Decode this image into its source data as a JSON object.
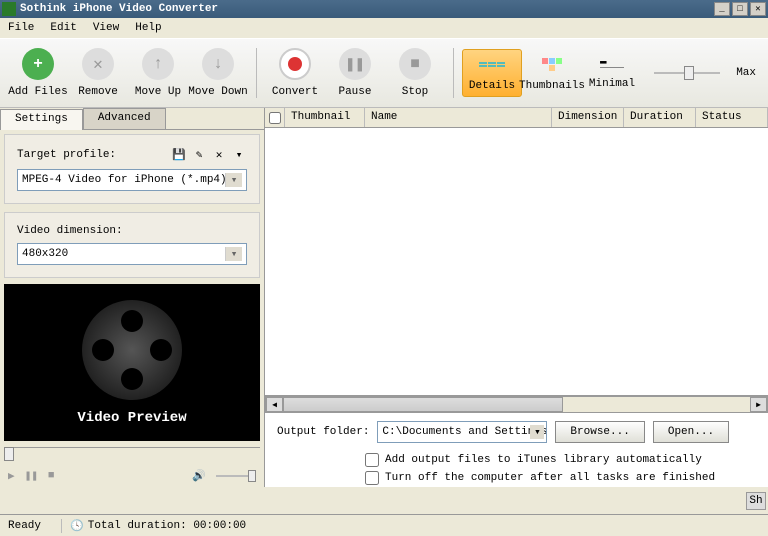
{
  "titlebar": {
    "title": "Sothink iPhone Video Converter"
  },
  "menu": {
    "file": "File",
    "edit": "Edit",
    "view": "View",
    "help": "Help"
  },
  "toolbar": {
    "add": "Add Files",
    "remove": "Remove",
    "moveup": "Move Up",
    "movedown": "Move Down",
    "convert": "Convert",
    "pause": "Pause",
    "stop": "Stop",
    "details": "Details",
    "thumbnails": "Thumbnails",
    "minimal": "Minimal",
    "max": "Max"
  },
  "tabs": {
    "settings": "Settings",
    "advanced": "Advanced"
  },
  "settings": {
    "target_label": "Target profile:",
    "target_value": "MPEG-4 Video for iPhone (*.mp4)",
    "dim_label": "Video dimension:",
    "dim_value": "480x320",
    "save_icon": "💾",
    "edit_icon": "✎",
    "del_icon": "✕"
  },
  "preview": {
    "label": "Video Preview"
  },
  "table": {
    "cols": {
      "thumb": "Thumbnail",
      "name": "Name",
      "dim": "Dimension",
      "dur": "Duration",
      "status": "Status"
    }
  },
  "output": {
    "label": "Output folder:",
    "path": "C:\\Documents and Settings\\A",
    "browse": "Browse...",
    "open": "Open...",
    "chk1": "Add output files to iTunes library automatically",
    "chk2": "Turn off the computer after all tasks are finished",
    "sh": "Sh"
  },
  "status": {
    "ready": "Ready",
    "duration": "Total duration:  00:00:00"
  },
  "playctrl": {
    "play": "▶",
    "pause": "❚❚",
    "stop": "■",
    "vol": "🔊"
  }
}
